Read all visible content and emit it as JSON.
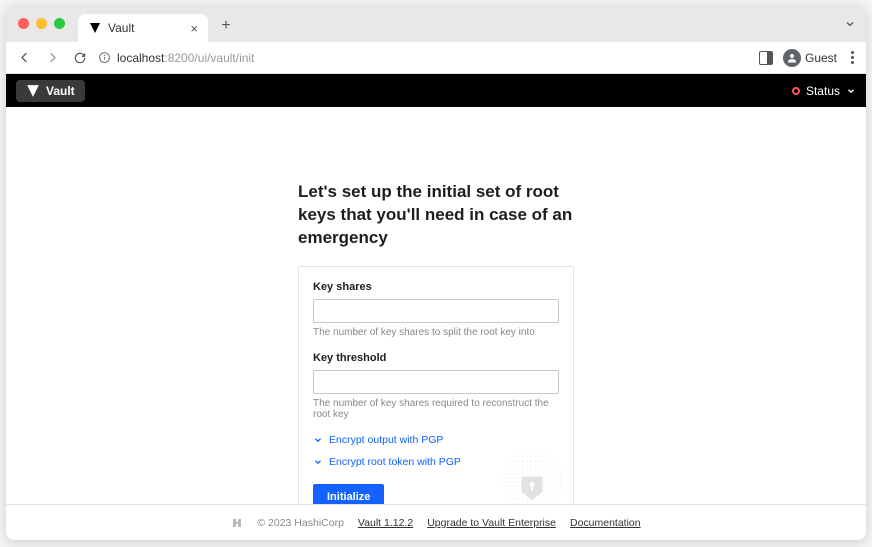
{
  "browser": {
    "tab_title": "Vault",
    "url_host": "localhost",
    "url_port_path": ":8200/ui/vault/init",
    "guest_label": "Guest"
  },
  "header": {
    "brand": "Vault",
    "status_label": "Status"
  },
  "page": {
    "headline": "Let's set up the initial set of root keys that you'll need in case of an emergency",
    "key_shares_label": "Key shares",
    "key_shares_help": "The number of key shares to split the root key into",
    "key_threshold_label": "Key threshold",
    "key_threshold_help": "The number of key shares required to reconstruct the root key",
    "encrypt_output_label": "Encrypt output with PGP",
    "encrypt_token_label": "Encrypt root token with PGP",
    "initialize_label": "Initialize"
  },
  "footer": {
    "copyright": "© 2023 HashiCorp",
    "version": "Vault 1.12.2",
    "upgrade": "Upgrade to Vault Enterprise",
    "docs": "Documentation"
  }
}
